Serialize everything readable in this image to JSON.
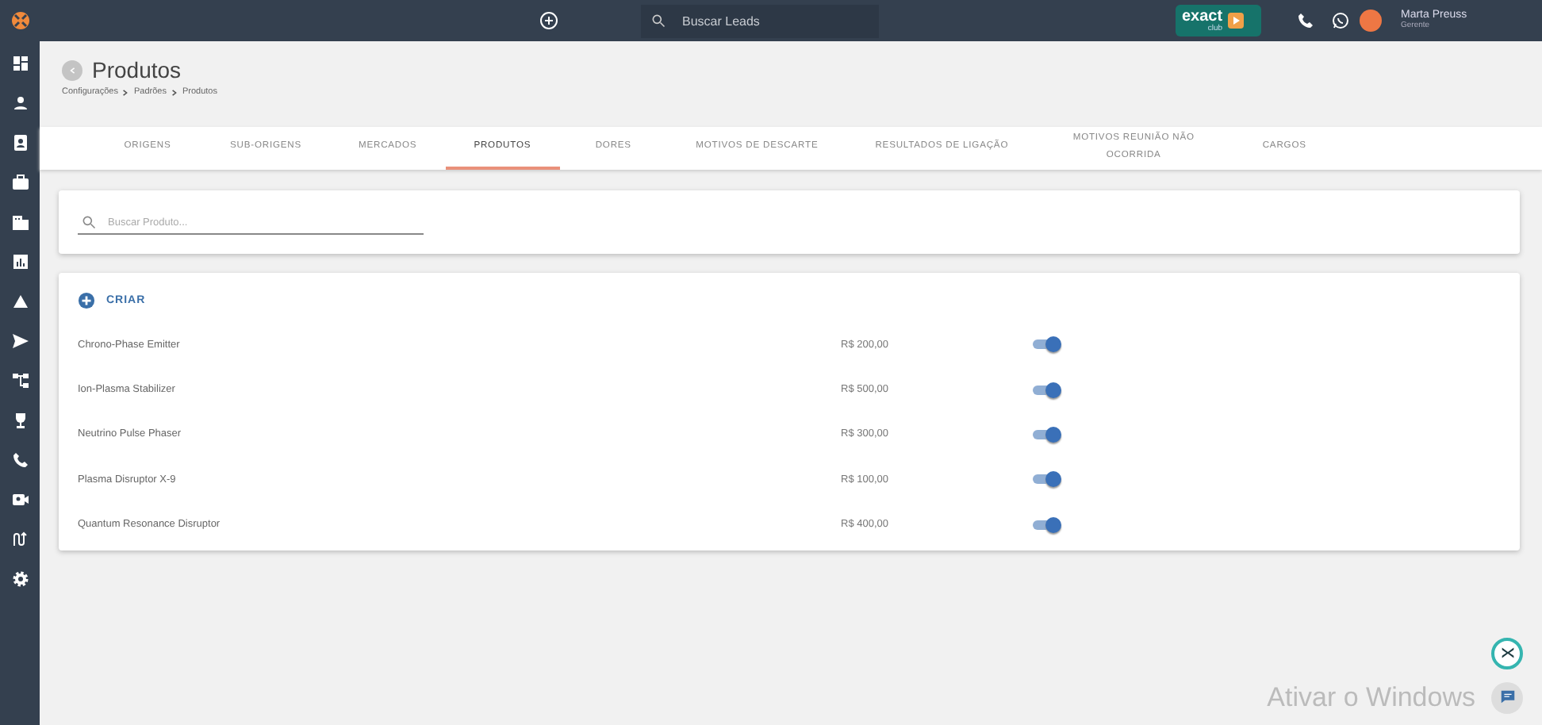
{
  "topbar": {
    "search": {
      "placeholder": "Buscar Leads"
    },
    "logo": {
      "word": "exact",
      "sub": "club"
    },
    "user": {
      "name": "Marta Preuss",
      "role": "Gerente"
    }
  },
  "sidebar": {
    "items": [
      {
        "kind": "dashboard"
      },
      {
        "kind": "person"
      },
      {
        "kind": "contact"
      },
      {
        "kind": "briefcase"
      },
      {
        "kind": "building"
      },
      {
        "kind": "chart"
      },
      {
        "kind": "shapes"
      },
      {
        "kind": "send"
      },
      {
        "kind": "tree"
      },
      {
        "kind": "trophy"
      },
      {
        "kind": "phone"
      },
      {
        "kind": "video"
      },
      {
        "kind": "route"
      },
      {
        "kind": "gear"
      }
    ]
  },
  "page": {
    "title": "Produtos",
    "breadcrumb": [
      "Configurações",
      "Padrões",
      "Produtos"
    ]
  },
  "tabs": [
    {
      "label": "ORIGENS",
      "selected": false
    },
    {
      "label": "SUB-ORIGENS",
      "selected": false
    },
    {
      "label": "MERCADOS",
      "selected": false
    },
    {
      "label": "PRODUTOS",
      "selected": true
    },
    {
      "label": "DORES",
      "selected": false
    },
    {
      "label": "MOTIVOS DE DESCARTE",
      "selected": false
    },
    {
      "label": "RESULTADOS DE LIGAÇÃO",
      "selected": false
    },
    {
      "label": "MOTIVOS REUNIÃO NÃO OCORRIDA",
      "selected": false
    },
    {
      "label": "CARGOS",
      "selected": false
    }
  ],
  "product_search": {
    "placeholder": "Buscar Produto..."
  },
  "create_label": "CRIAR",
  "products": [
    {
      "name": "Chrono-Phase Emitter",
      "price": "R$ 200,00",
      "active": true
    },
    {
      "name": "Ion-Plasma Stabilizer",
      "price": "R$ 500,00",
      "active": true
    },
    {
      "name": "Neutrino Pulse Phaser",
      "price": "R$ 300,00",
      "active": true
    },
    {
      "name": "Plasma Disruptor X-9",
      "price": "R$ 100,00",
      "active": true
    },
    {
      "name": "Quantum Resonance Disruptor",
      "price": "R$ 400,00",
      "active": true
    }
  ],
  "os_notice": "Ativar o Windows"
}
